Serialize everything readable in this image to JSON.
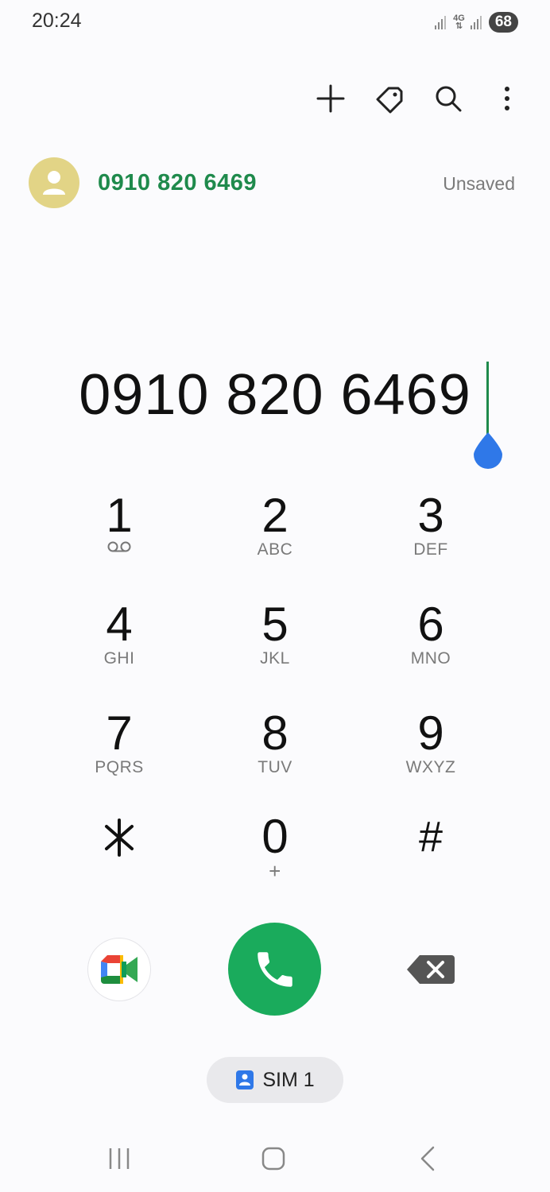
{
  "status_bar": {
    "time": "20:24",
    "network": "4G",
    "battery": "68"
  },
  "toolbar": {
    "add_icon": "plus-icon",
    "tag_icon": "tag-icon",
    "search_icon": "search-icon",
    "more_icon": "more-vertical-icon"
  },
  "contact_suggestion": {
    "number": "0910 820 6469",
    "status": "Unsaved",
    "avatar_color": "#e2d486",
    "number_color": "#1f8a4c"
  },
  "dialer": {
    "number": "0910 820 6469"
  },
  "keypad": {
    "keys": [
      {
        "digit": "1",
        "letters": ""
      },
      {
        "digit": "2",
        "letters": "ABC"
      },
      {
        "digit": "3",
        "letters": "DEF"
      },
      {
        "digit": "4",
        "letters": "GHI"
      },
      {
        "digit": "5",
        "letters": "JKL"
      },
      {
        "digit": "6",
        "letters": "MNO"
      },
      {
        "digit": "7",
        "letters": "PQRS"
      },
      {
        "digit": "8",
        "letters": "TUV"
      },
      {
        "digit": "9",
        "letters": "WXYZ"
      },
      {
        "digit": "⁎",
        "letters": ""
      },
      {
        "digit": "0",
        "letters": "+"
      },
      {
        "digit": "#",
        "letters": ""
      }
    ]
  },
  "actions": {
    "call_color": "#1aab5c",
    "sim_label": "SIM 1"
  },
  "nav_bar": {
    "recents_icon": "recents-icon",
    "home_icon": "home-icon",
    "back_icon": "back-icon"
  }
}
